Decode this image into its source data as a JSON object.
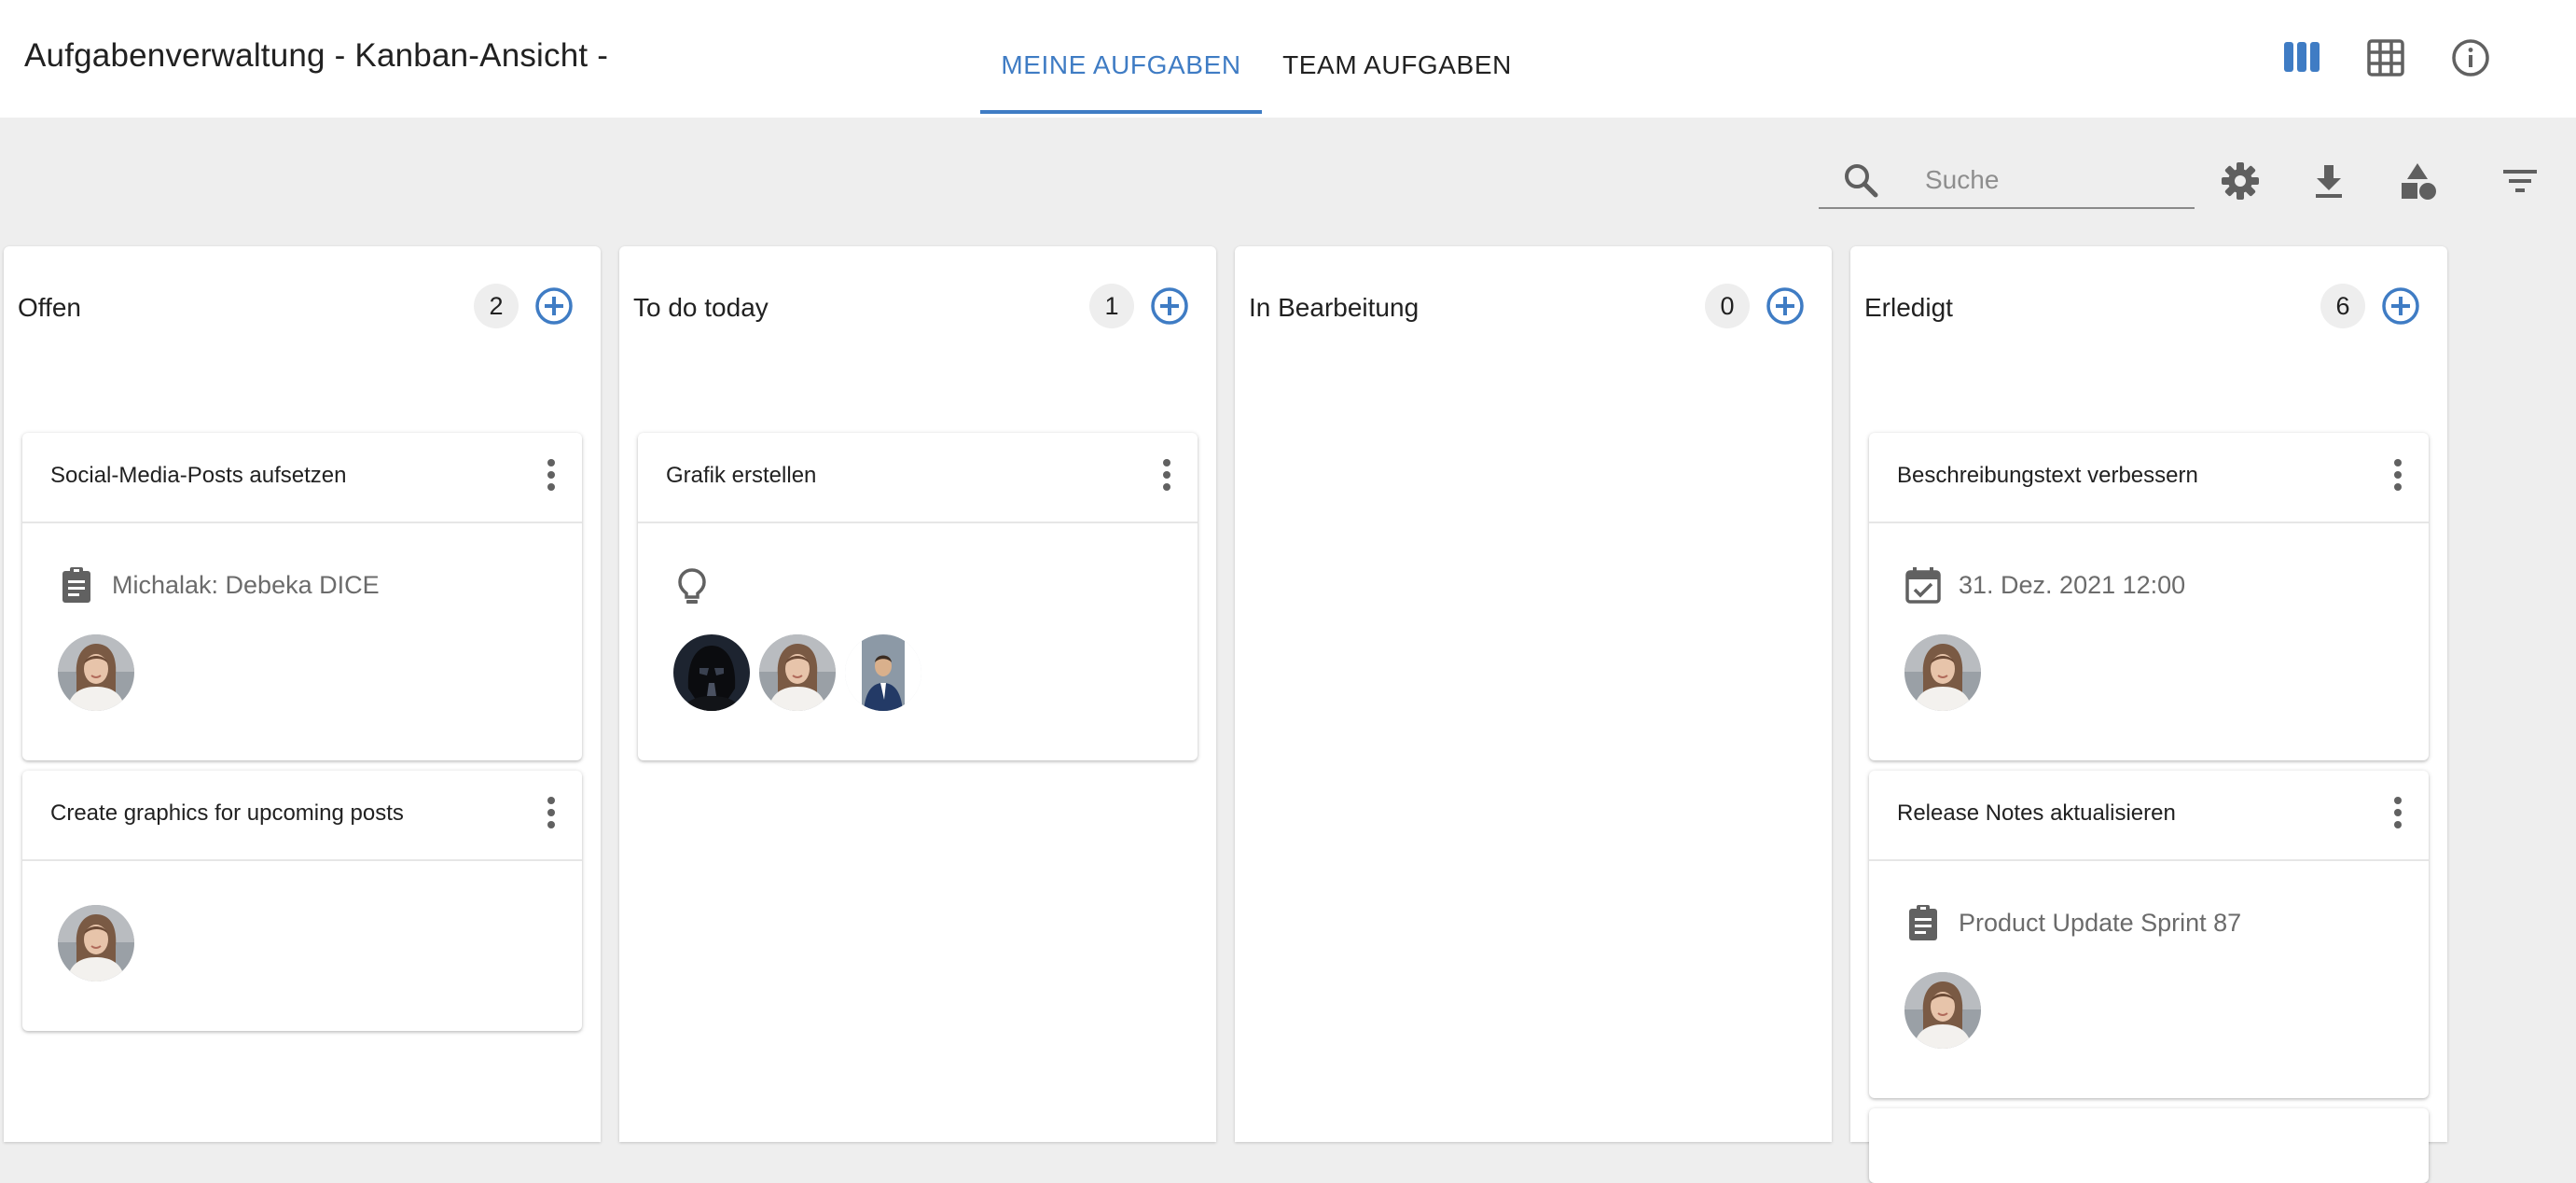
{
  "header": {
    "title": "Aufgabenverwaltung - Kanban-Ansicht -",
    "tabs": [
      {
        "label": "MEINE AUFGABEN",
        "active": true
      },
      {
        "label": "TEAM AUFGABEN",
        "active": false
      }
    ],
    "view_icons": [
      "kanban-view-icon",
      "table-view-icon",
      "info-icon"
    ],
    "accent_color": "#3f7cc4"
  },
  "toolbar": {
    "search_placeholder": "Suche",
    "search_value": "",
    "icons": [
      "settings-icon",
      "download-icon",
      "shapes-icon",
      "filter-icon"
    ]
  },
  "columns": [
    {
      "title": "Offen",
      "count": "2",
      "cards": [
        {
          "title": "Social-Media-Posts aufsetzen",
          "meta_icon": "clipboard-icon",
          "meta_text": "Michalak: Debeka DICE",
          "assignees": [
            "woman-avatar"
          ]
        },
        {
          "title": "Create graphics for upcoming posts",
          "assignees": [
            "woman-avatar"
          ]
        }
      ]
    },
    {
      "title": "To do today",
      "count": "1",
      "cards": [
        {
          "title": "Grafik erstellen",
          "meta_icon": "lightbulb-icon",
          "assignees": [
            "helmet-avatar",
            "woman-avatar",
            "man-suit-avatar"
          ]
        }
      ]
    },
    {
      "title": "In Bearbeitung",
      "count": "0",
      "cards": []
    },
    {
      "title": "Erledigt",
      "count": "6",
      "cards": [
        {
          "title": "Beschreibungstext verbessern",
          "meta_icon": "calendar-check-icon",
          "meta_text": "31. Dez. 2021 12:00",
          "assignees": [
            "woman-avatar"
          ]
        },
        {
          "title": "Release Notes aktualisieren",
          "meta_icon": "clipboard-icon",
          "meta_text": "Product Update Sprint 87",
          "assignees": [
            "woman-avatar"
          ]
        }
      ]
    }
  ]
}
